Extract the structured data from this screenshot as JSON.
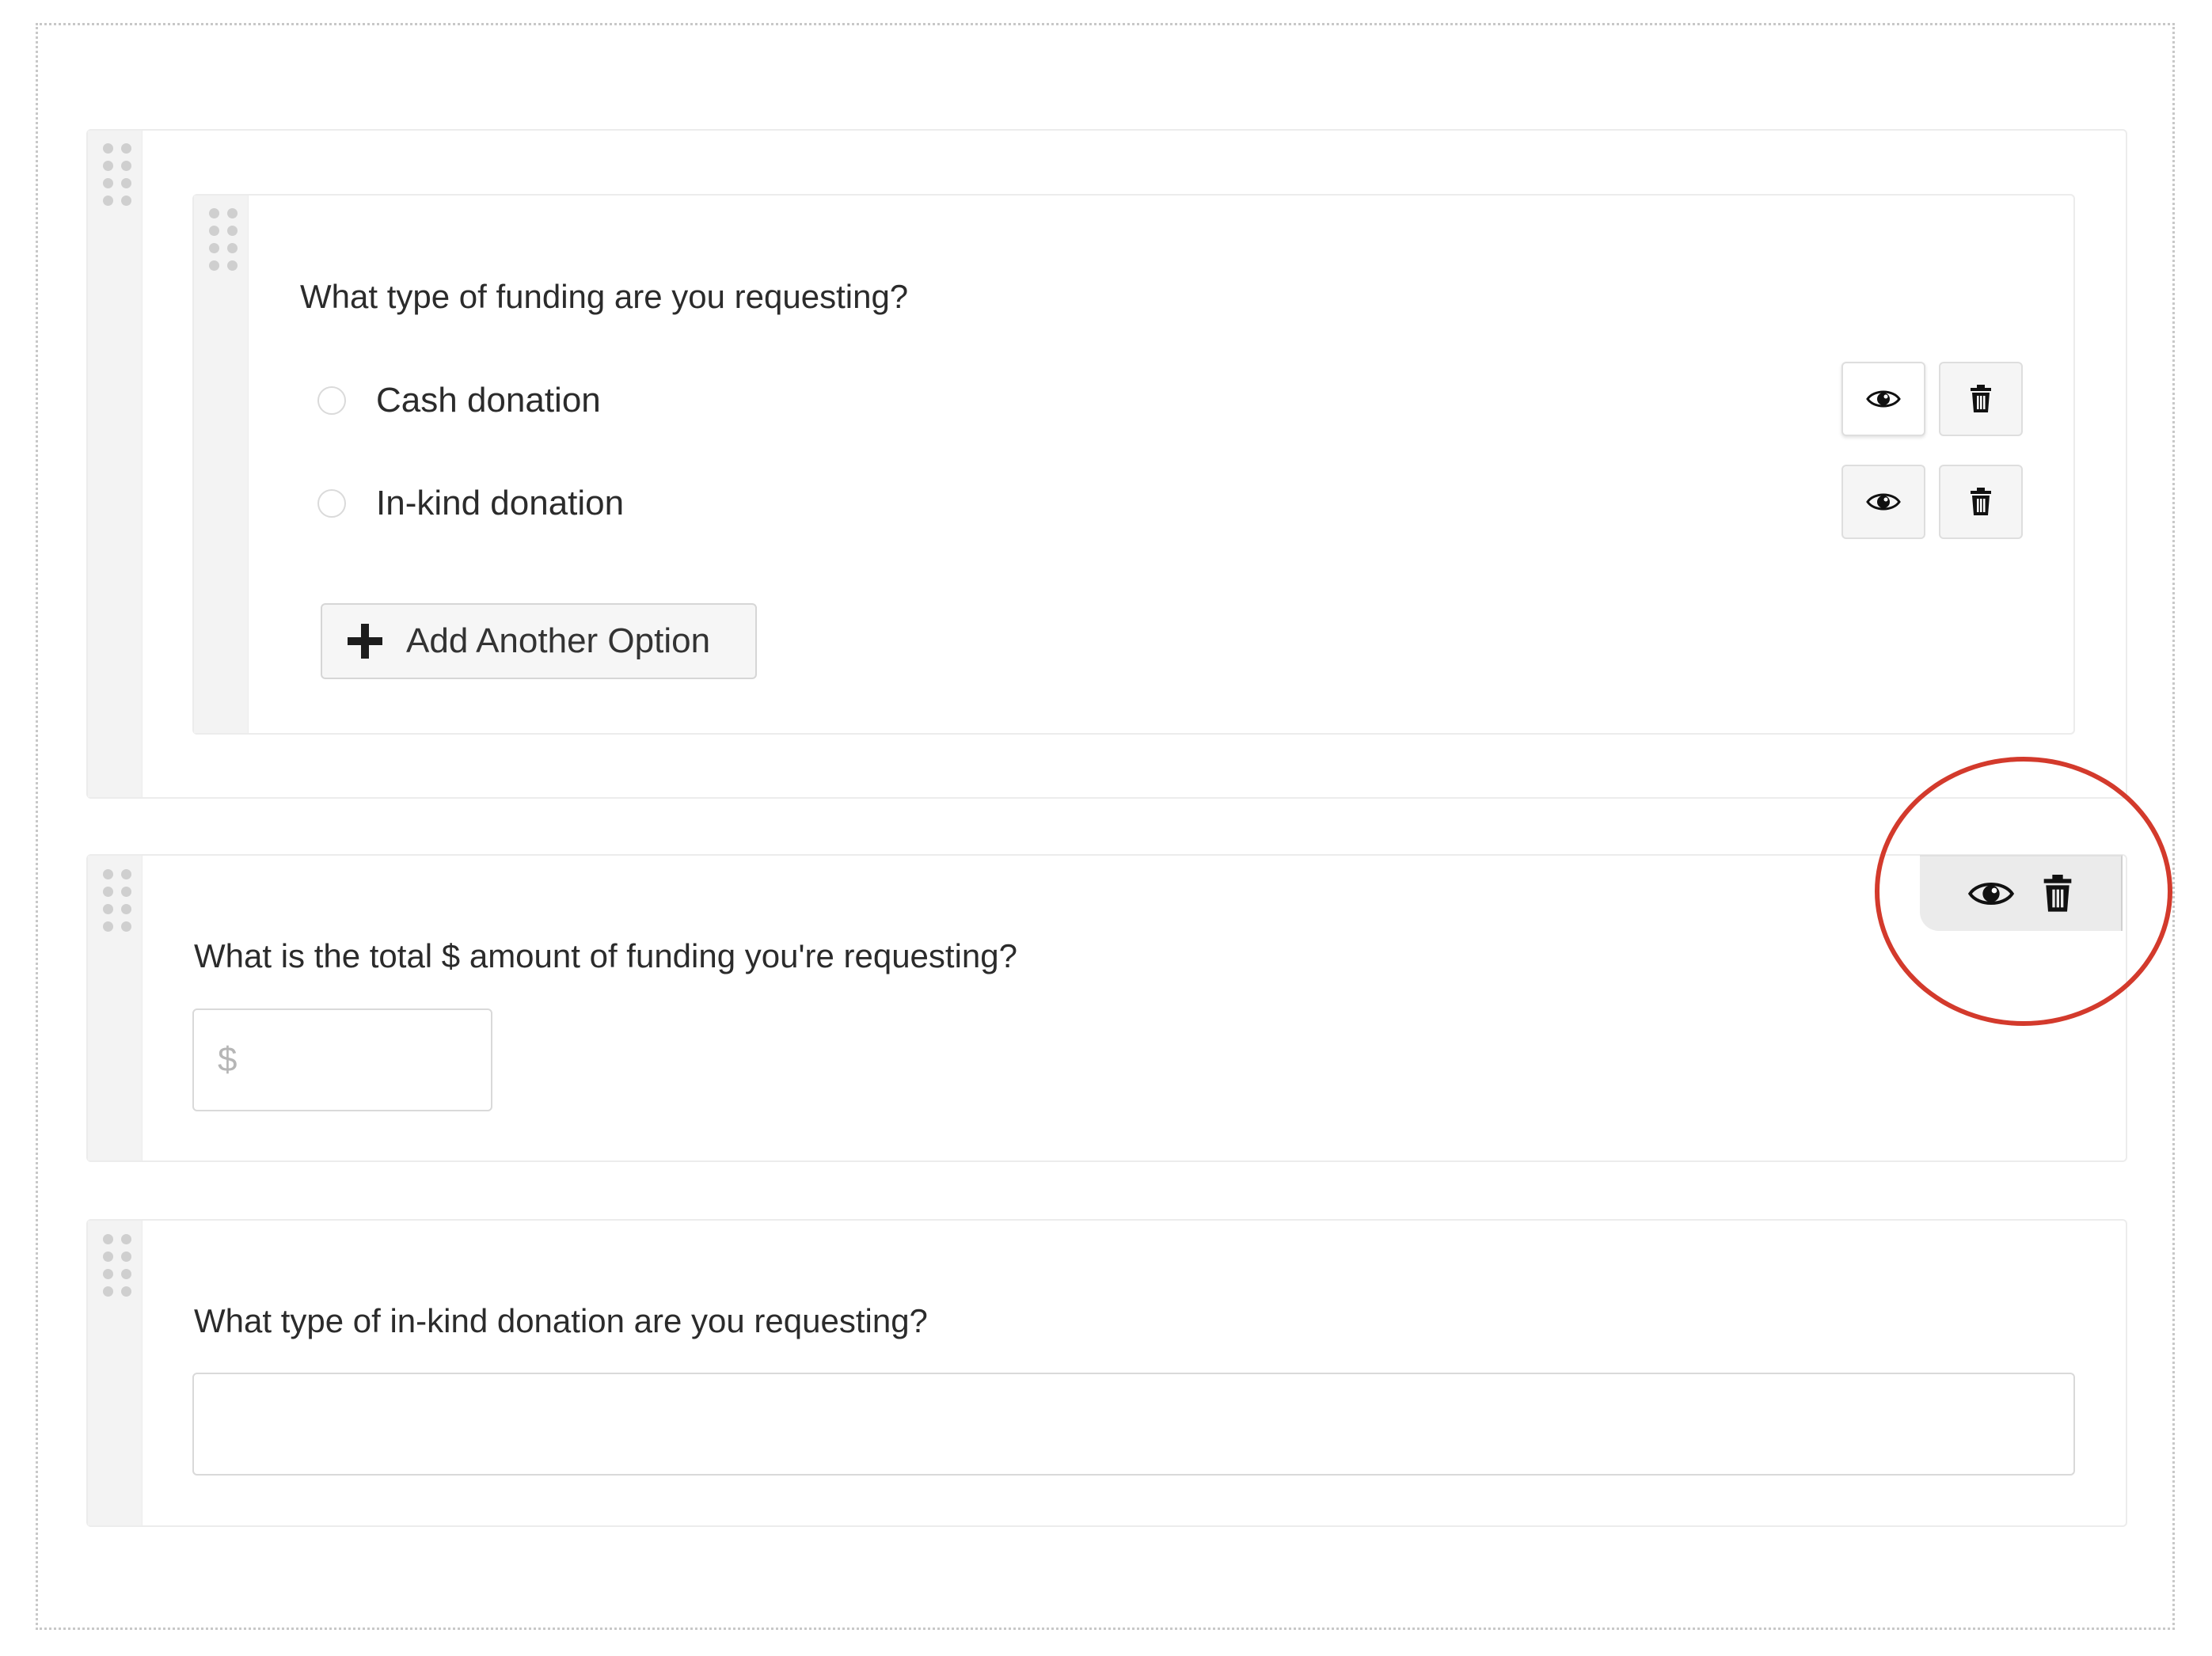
{
  "blocks": [
    {
      "question": "What type of funding are you requesting?",
      "options": [
        {
          "label": "Cash donation"
        },
        {
          "label": "In-kind donation"
        }
      ],
      "add_option_label": "Add Another Option"
    },
    {
      "question": "What is the total $ amount of funding you're requesting?",
      "input": {
        "value": "",
        "placeholder": "$"
      }
    },
    {
      "question": "What type of in-kind donation are you requesting?",
      "input": {
        "value": "",
        "placeholder": ""
      }
    }
  ],
  "icons": {
    "visibility": "eye-icon",
    "delete": "trash-icon",
    "drag": "drag-handle-icon",
    "add": "plus-icon"
  },
  "colors": {
    "annotation": "#d33a2c",
    "handle_bg": "#f3f3f3",
    "grip_dot": "#cfcfcf"
  }
}
